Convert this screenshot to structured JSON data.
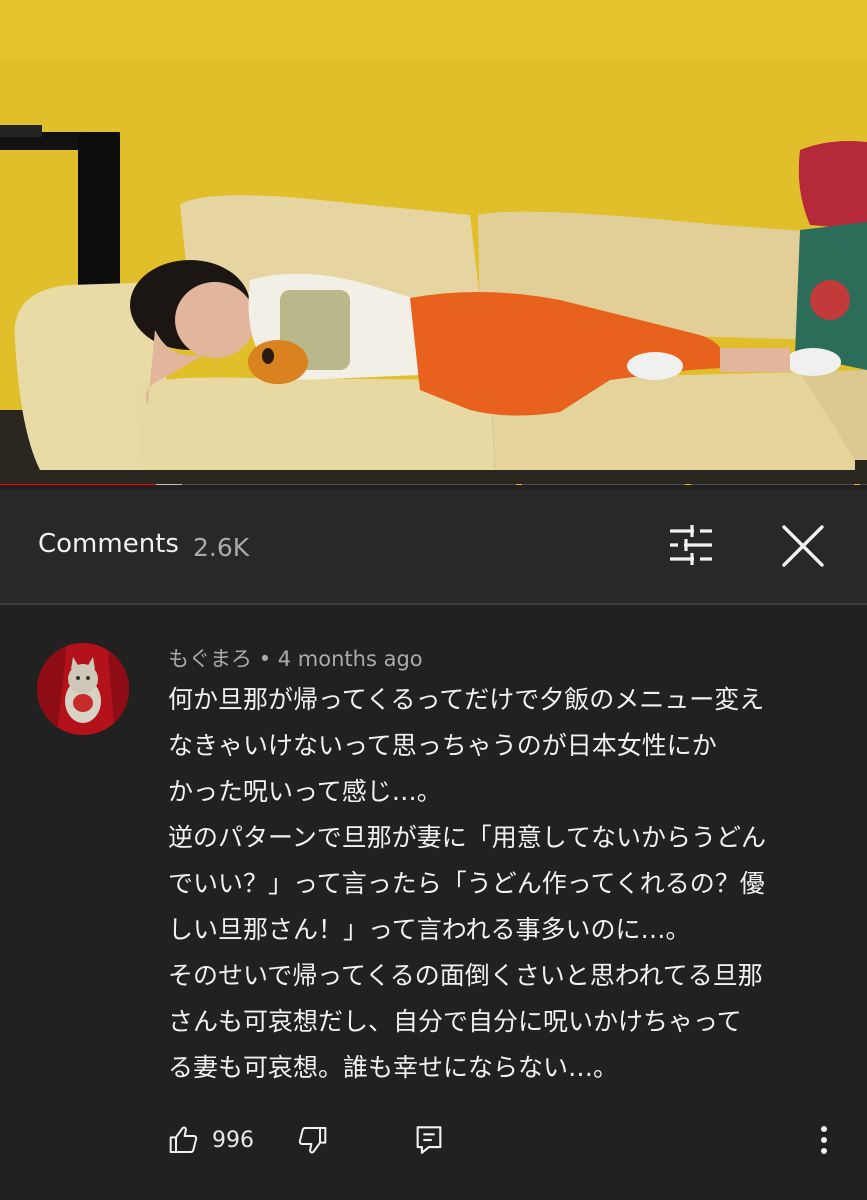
{
  "video": {
    "progress_fraction": 0.18,
    "buffered_fraction": 0.21,
    "chapter_markers": [
      0.595,
      0.79,
      0.985
    ],
    "colors": {
      "played": "#ff0000",
      "background": "#4d4d4d",
      "marker": "#f4b400"
    }
  },
  "comments_panel": {
    "title": "Comments",
    "count": "2.6K",
    "filter_icon": "sort-filter-icon",
    "close_icon": "close-icon"
  },
  "comment": {
    "author": "もぐまろ",
    "separator": "•",
    "time": "4 months ago",
    "meta": "もぐまろ • 4 months ago",
    "lines": [
      "何か旦那が帰ってくるってだけで夕飯のメニュー変え",
      "なきゃいけないって思っちゃうのが日本女性にか",
      "かった呪いって感じ…。",
      "逆のパターンで旦那が妻に「用意してないからうどん",
      "でいい？」って言ったら「うどん作ってくれるの？優",
      "しい旦那さん！」って言われる事多いのに…。",
      "そのせいで帰ってくるの面倒くさいと思われてる旦那",
      "さんも可哀想だし、自分で自分に呪いかけちゃって",
      "る妻も可哀想。誰も幸せにならない…。"
    ],
    "likes": "996",
    "icons": {
      "like": "thumbs-up-icon",
      "dislike": "thumbs-down-icon",
      "reply": "reply-comment-icon",
      "more": "more-vert-icon"
    }
  }
}
